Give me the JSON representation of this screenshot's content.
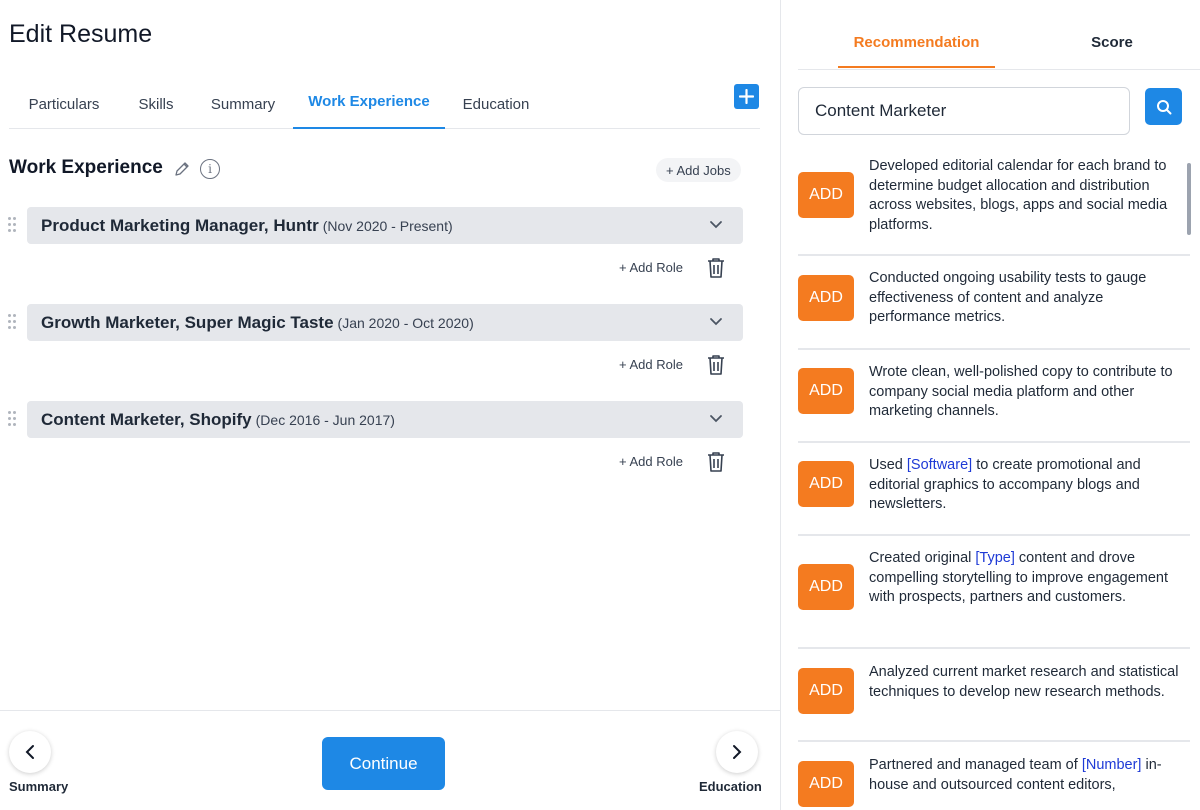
{
  "page": {
    "title": "Edit Resume"
  },
  "tabs": [
    {
      "label": "Particulars"
    },
    {
      "label": "Skills"
    },
    {
      "label": "Summary"
    },
    {
      "label": "Work Experience",
      "active": true
    },
    {
      "label": "Education"
    }
  ],
  "section": {
    "title": "Work Experience",
    "add_jobs_label": "+ Add Jobs"
  },
  "jobs": [
    {
      "title": "Product Marketing Manager, Huntr",
      "dates": "(Nov 2020 - Present)",
      "add_role_label": "+ Add Role"
    },
    {
      "title": "Growth Marketer, Super Magic Taste",
      "dates": "(Jan 2020 - Oct 2020)",
      "add_role_label": "+ Add Role"
    },
    {
      "title": "Content Marketer, Shopify",
      "dates": "(Dec 2016 - Jun 2017)",
      "add_role_label": "+ Add Role"
    }
  ],
  "footer": {
    "prev_label": "Summary",
    "next_label": "Education",
    "continue_label": "Continue"
  },
  "right_panel": {
    "tabs": [
      {
        "label": "Recommendation",
        "active": true
      },
      {
        "label": "Score"
      }
    ],
    "search": {
      "value": "Content Marketer",
      "placeholder": ""
    },
    "add_label": "ADD",
    "recommendations": [
      {
        "parts": [
          "Developed editorial calendar for each brand to determine budget allocation and distribution across websites, blogs, apps and social media platforms."
        ]
      },
      {
        "parts": [
          "Conducted ongoing usability tests to gauge effectiveness of content and analyze performance metrics."
        ]
      },
      {
        "parts": [
          "Wrote clean, well-polished copy to contribute to company social media platform and other marketing channels."
        ]
      },
      {
        "parts": [
          "Used ",
          "[Software]",
          " to create promotional and editorial graphics to accompany blogs and newsletters."
        ]
      },
      {
        "parts": [
          "Created original ",
          "[Type]",
          " content and drove compelling storytelling to improve engagement with prospects, partners and customers."
        ]
      },
      {
        "parts": [
          "Analyzed current market research and statistical techniques to develop new research methods."
        ]
      },
      {
        "parts": [
          "Partnered and managed team of ",
          "[Number]",
          " in-house and outsourced content editors,"
        ]
      }
    ]
  },
  "colors": {
    "accent_blue": "#1e88e5",
    "accent_orange": "#f47b20",
    "placeholder_text": "#1e3ad6",
    "job_bar": "#e5e7eb"
  },
  "icons": [
    "plus-icon",
    "pencil-icon",
    "info-icon",
    "drag-handle-icon",
    "chevron-down-icon",
    "trash-icon",
    "chevron-left-icon",
    "chevron-right-icon",
    "search-icon"
  ]
}
